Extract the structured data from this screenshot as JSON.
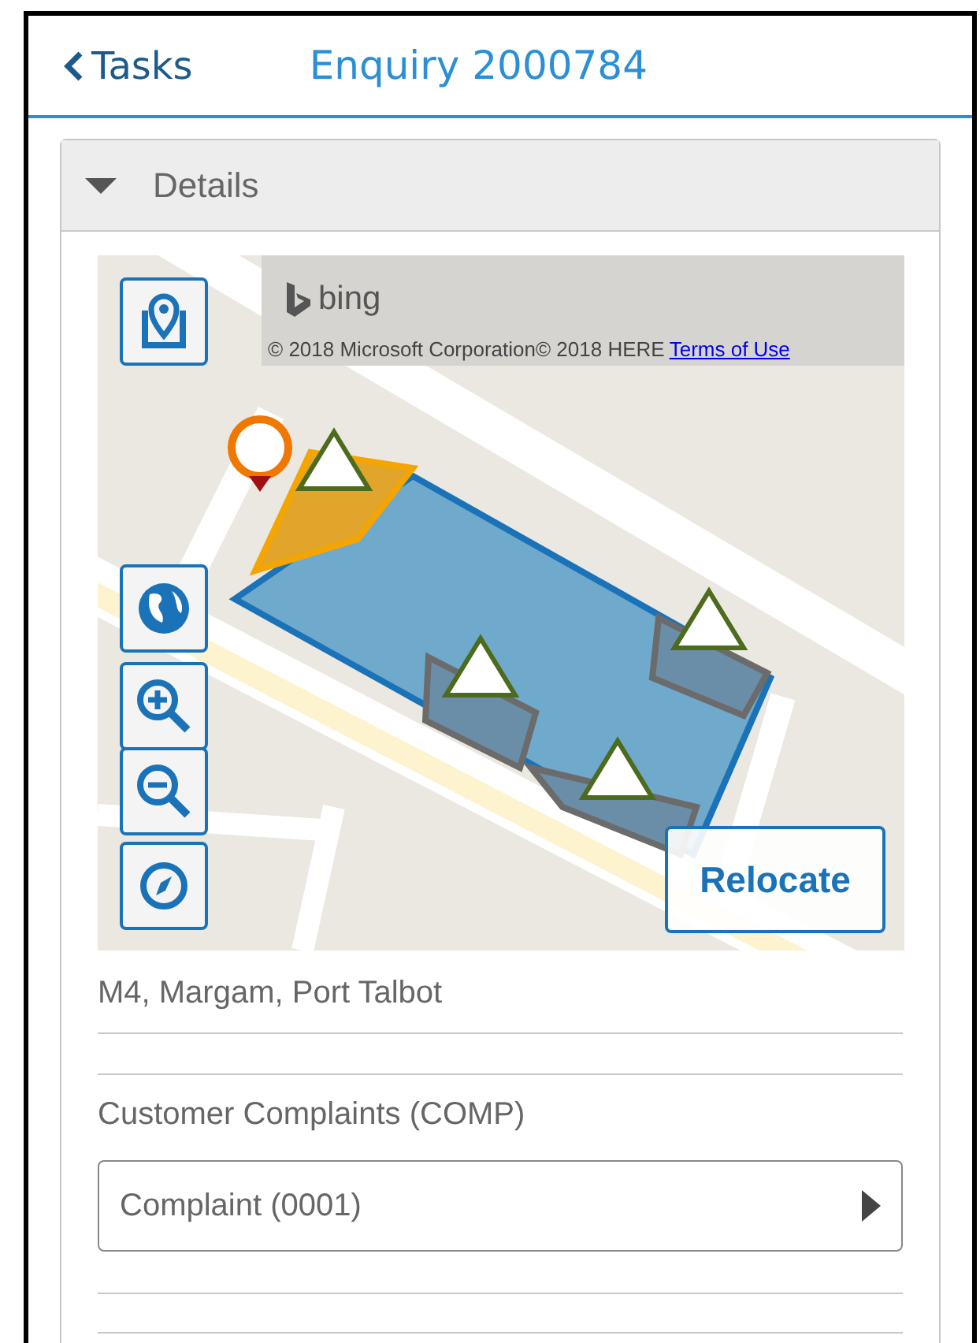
{
  "header": {
    "back_label": "Tasks",
    "title": "Enquiry 2000784"
  },
  "details": {
    "title": "Details",
    "expanded": true,
    "map": {
      "logo_text": "bing",
      "attribution": "© 2018 Microsoft Corporation© 2018 HERE",
      "terms_link": "Terms of Use",
      "relocate_button": "Relocate"
    },
    "address": "M4, Margam, Port Talbot",
    "category": "Customer Complaints (COMP)",
    "subcategory": "Complaint (0001)"
  }
}
